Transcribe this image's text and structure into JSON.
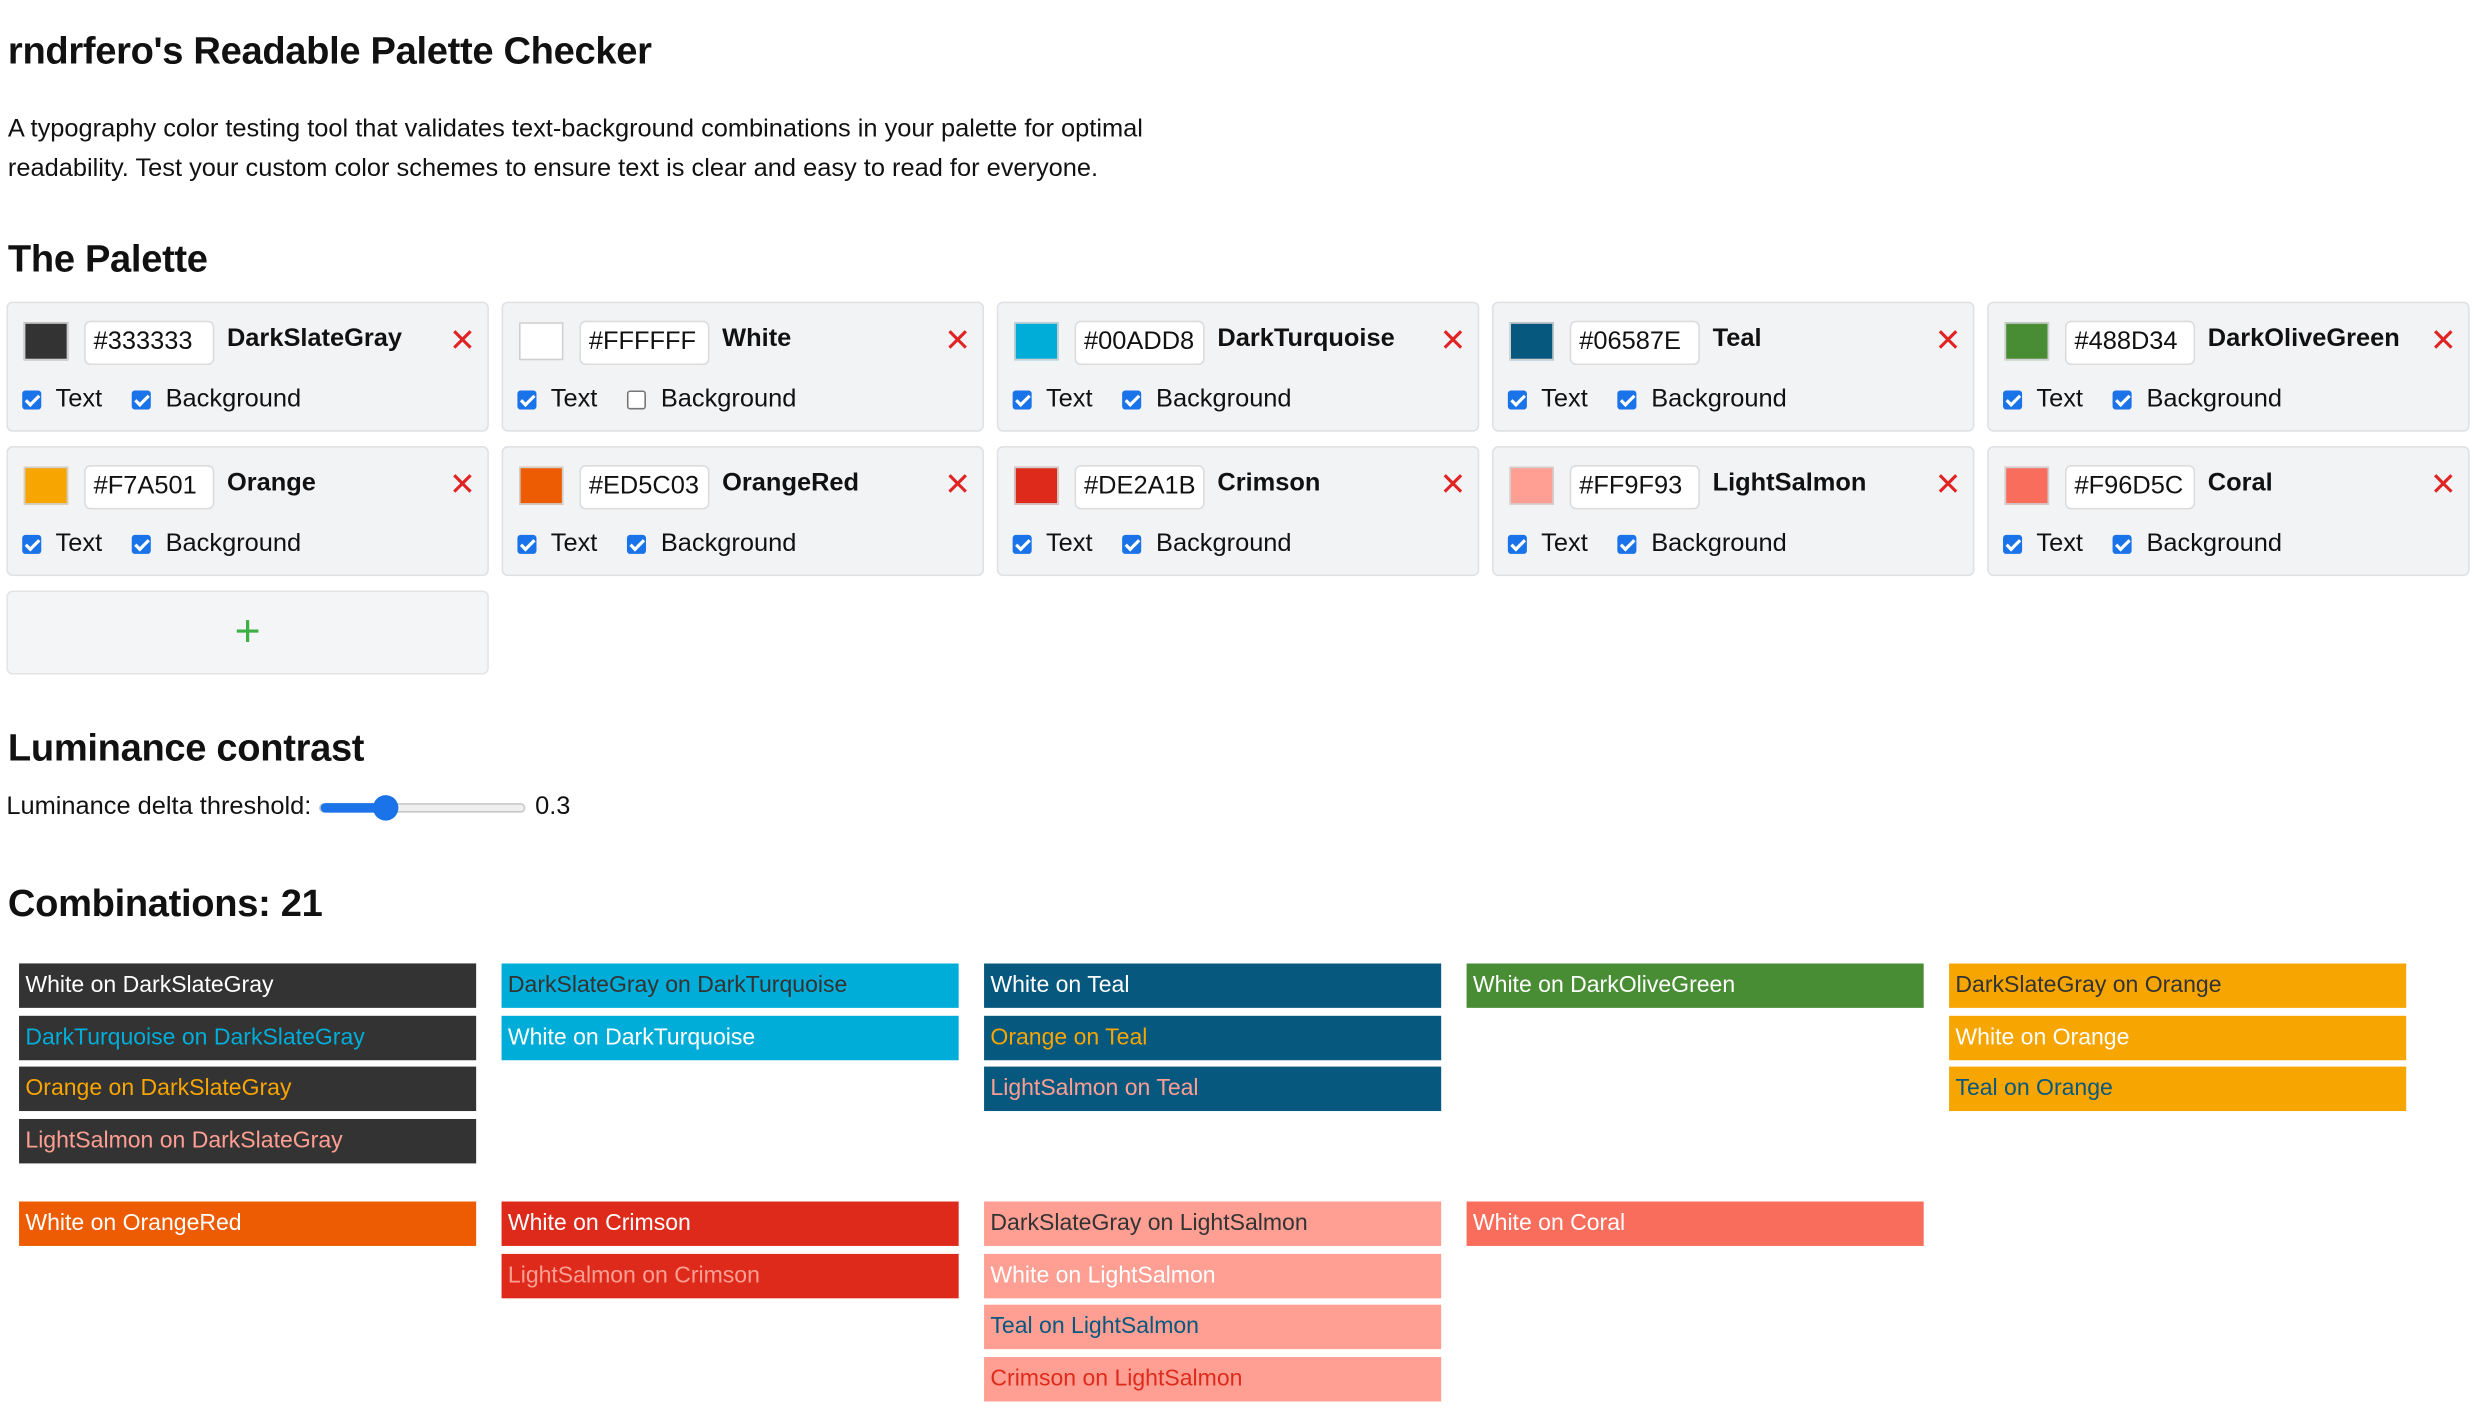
{
  "app": {
    "title": "rndrfero's Readable Palette Checker",
    "description": "A typography color testing tool that validates text-background combinations in your palette for optimal readability. Test your custom color schemes to ensure text is clear and easy to read for everyone."
  },
  "palette": {
    "heading": "The Palette",
    "text_label": "Text",
    "background_label": "Background",
    "remove_icon": "close-icon",
    "add_icon": "plus-icon",
    "colors": [
      {
        "hex": "#333333",
        "name": "DarkSlateGray",
        "text": true,
        "background": true
      },
      {
        "hex": "#FFFFFF",
        "name": "White",
        "text": true,
        "background": false
      },
      {
        "hex": "#00ADD8",
        "name": "DarkTurquoise",
        "text": true,
        "background": true
      },
      {
        "hex": "#06587E",
        "name": "Teal",
        "text": true,
        "background": true
      },
      {
        "hex": "#488D34",
        "name": "DarkOliveGreen",
        "text": true,
        "background": true
      },
      {
        "hex": "#F7A501",
        "name": "Orange",
        "text": true,
        "background": true
      },
      {
        "hex": "#ED5C03",
        "name": "OrangeRed",
        "text": true,
        "background": true
      },
      {
        "hex": "#DE2A1B",
        "name": "Crimson",
        "text": true,
        "background": true
      },
      {
        "hex": "#FF9F93",
        "name": "LightSalmon",
        "text": true,
        "background": true
      },
      {
        "hex": "#F96D5C",
        "name": "Coral",
        "text": true,
        "background": true
      }
    ]
  },
  "luminance": {
    "heading": "Luminance contrast",
    "threshold_label": "Luminance delta threshold:",
    "threshold_value": "0.3",
    "slider_fraction": 0.32
  },
  "combinations": {
    "heading": "Combinations: 21",
    "groups": [
      {
        "bg": "#333333",
        "items": [
          {
            "label": "White on DarkSlateGray",
            "fg": "#FFFFFF"
          },
          {
            "label": "DarkTurquoise on DarkSlateGray",
            "fg": "#00ADD8"
          },
          {
            "label": "Orange on DarkSlateGray",
            "fg": "#F7A501"
          },
          {
            "label": "LightSalmon on DarkSlateGray",
            "fg": "#FF9F93"
          }
        ]
      },
      {
        "bg": "#00ADD8",
        "items": [
          {
            "label": "DarkSlateGray on DarkTurquoise",
            "fg": "#333333"
          },
          {
            "label": "White on DarkTurquoise",
            "fg": "#FFFFFF"
          }
        ]
      },
      {
        "bg": "#06587E",
        "items": [
          {
            "label": "White on Teal",
            "fg": "#FFFFFF"
          },
          {
            "label": "Orange on Teal",
            "fg": "#F7A501"
          },
          {
            "label": "LightSalmon on Teal",
            "fg": "#FF9F93"
          }
        ]
      },
      {
        "bg": "#488D34",
        "items": [
          {
            "label": "White on DarkOliveGreen",
            "fg": "#FFFFFF"
          }
        ]
      },
      {
        "bg": "#F7A501",
        "items": [
          {
            "label": "DarkSlateGray on Orange",
            "fg": "#333333"
          },
          {
            "label": "White on Orange",
            "fg": "#FFFFFF"
          },
          {
            "label": "Teal on Orange",
            "fg": "#06587E"
          }
        ]
      },
      {
        "bg": "#ED5C03",
        "items": [
          {
            "label": "White on OrangeRed",
            "fg": "#FFFFFF"
          }
        ]
      },
      {
        "bg": "#DE2A1B",
        "items": [
          {
            "label": "White on Crimson",
            "fg": "#FFFFFF"
          },
          {
            "label": "LightSalmon on Crimson",
            "fg": "#FF9F93"
          }
        ]
      },
      {
        "bg": "#FF9F93",
        "items": [
          {
            "label": "DarkSlateGray on LightSalmon",
            "fg": "#333333"
          },
          {
            "label": "White on LightSalmon",
            "fg": "#FFFFFF"
          },
          {
            "label": "Teal on LightSalmon",
            "fg": "#06587E"
          },
          {
            "label": "Crimson on LightSalmon",
            "fg": "#DE2A1B"
          }
        ]
      },
      {
        "bg": "#F96D5C",
        "items": [
          {
            "label": "White on Coral",
            "fg": "#FFFFFF"
          }
        ]
      }
    ]
  }
}
